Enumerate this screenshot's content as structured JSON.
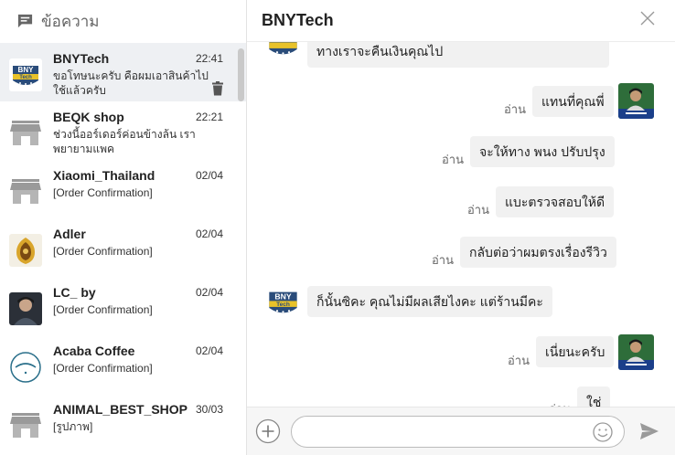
{
  "left_header": {
    "title": "ข้อความ"
  },
  "conversations": [
    {
      "name": "BNYTech",
      "time": "22:41",
      "snippet": "ขอโทษนะครับ คือผมเอาสินค้าไปใช้แล้วครับ",
      "avatar": "bnytech-logo"
    },
    {
      "name": "BEQK shop",
      "time": "22:21",
      "snippet": "ช่วงนี้ออร์เดอร์ค่อนข้างล้น เราพยายามแพค",
      "avatar": "shop-icon"
    },
    {
      "name": "Xiaomi_Thailand",
      "time": "02/04",
      "snippet": "[Order Confirmation]",
      "avatar": "shop-icon"
    },
    {
      "name": "Adler",
      "time": "02/04",
      "snippet": "[Order Confirmation]",
      "avatar": "adler-logo"
    },
    {
      "name": "LC_ by",
      "time": "02/04",
      "snippet": "[Order Confirmation]",
      "avatar": "photo-avatar"
    },
    {
      "name": "Acaba Coffee",
      "time": "02/04",
      "snippet": "[Order Confirmation]",
      "avatar": "acaba-logo"
    },
    {
      "name": "ANIMAL_BEST_SHOP",
      "time": "30/03",
      "snippet": "[รูปภาพ]",
      "avatar": "shop-icon"
    }
  ],
  "chat": {
    "title": "BNYTech",
    "read_label": "อ่าน",
    "messages": [
      {
        "from": "them",
        "text": "ทางเราจะคืนเงินคุณไป"
      },
      {
        "from": "me",
        "text": "แทนที่คุณพี่"
      },
      {
        "from": "me",
        "text": "จะให้ทาง พนง ปรับปรุง"
      },
      {
        "from": "me",
        "text": "แบะตรวจสอบให้ดี"
      },
      {
        "from": "me",
        "text": "กลับต่อว่าผมตรงเรื่องรีวิว"
      },
      {
        "from": "them",
        "text": "ก็นั้นซิคะ คุณไม่มีผลเสียไงคะ แต่ร้านมีคะ"
      },
      {
        "from": "me",
        "text": "เนี่ยนะครับ"
      },
      {
        "from": "me",
        "text": "ใช่"
      }
    ]
  },
  "composer": {
    "value": "",
    "placeholder": ""
  },
  "colors": {
    "accent": "#1e5aa0",
    "bubble": "#f1f1f1",
    "active_row": "#eef0f3"
  }
}
